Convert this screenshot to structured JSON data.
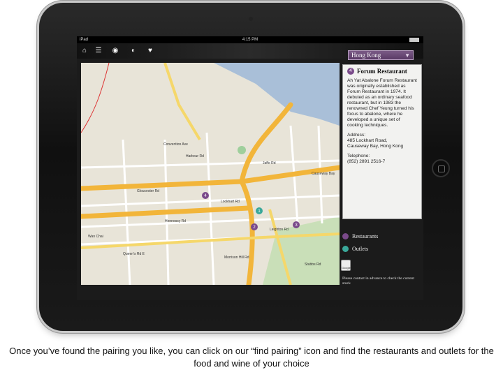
{
  "status_bar": {
    "carrier": "iPad",
    "time": "4:15 PM"
  },
  "toolbar": {
    "icons": [
      "home-icon",
      "list-icon",
      "location-pin-icon",
      "pie-chart-icon",
      "heart-icon"
    ]
  },
  "city_select": {
    "value": "Hong Kong"
  },
  "map": {
    "labels": [
      "Gloucester Rd",
      "Harbour Rd",
      "Convention Ave",
      "Hennessy Rd",
      "Lockhart Rd",
      "Jaffe Rd",
      "Queen's Rd E",
      "Wan Chai",
      "Causeway Bay",
      "Leighton Rd",
      "Morrison Hill Rd",
      "Stubbs Rd"
    ],
    "markers": [
      "1",
      "2",
      "3",
      "4"
    ]
  },
  "info_panel": {
    "number": "4",
    "title": "Forum Restaurant",
    "description": "Ah Yat Abalone Forum Restaurant was originally established as Forum Restaurant in 1974. It debuted as an ordinary seafood restaurant, but in 1983 the renowned Chef Yeung turned his focus to abalone, where he developed a unique set of cooking techniques.",
    "address_label": "Address:",
    "address_line1": "485 Lockhart Road,",
    "address_line2": "Causeway Bay, Hong Kong",
    "phone_label": "Telephone:",
    "phone": "(852) 2891 2516-7"
  },
  "legend": {
    "restaurants": "Restaurants",
    "outlets": "Outlets",
    "restaurant_color": "#7a4a8a",
    "outlet_color": "#3aa89a"
  },
  "google_button": "Google",
  "note": "Please contact in advance to check the current stock",
  "caption": "Once you’ve found the pairing you like, you can click on our “find pairing” icon and find the restaurants and outlets for the food and wine of your choice"
}
